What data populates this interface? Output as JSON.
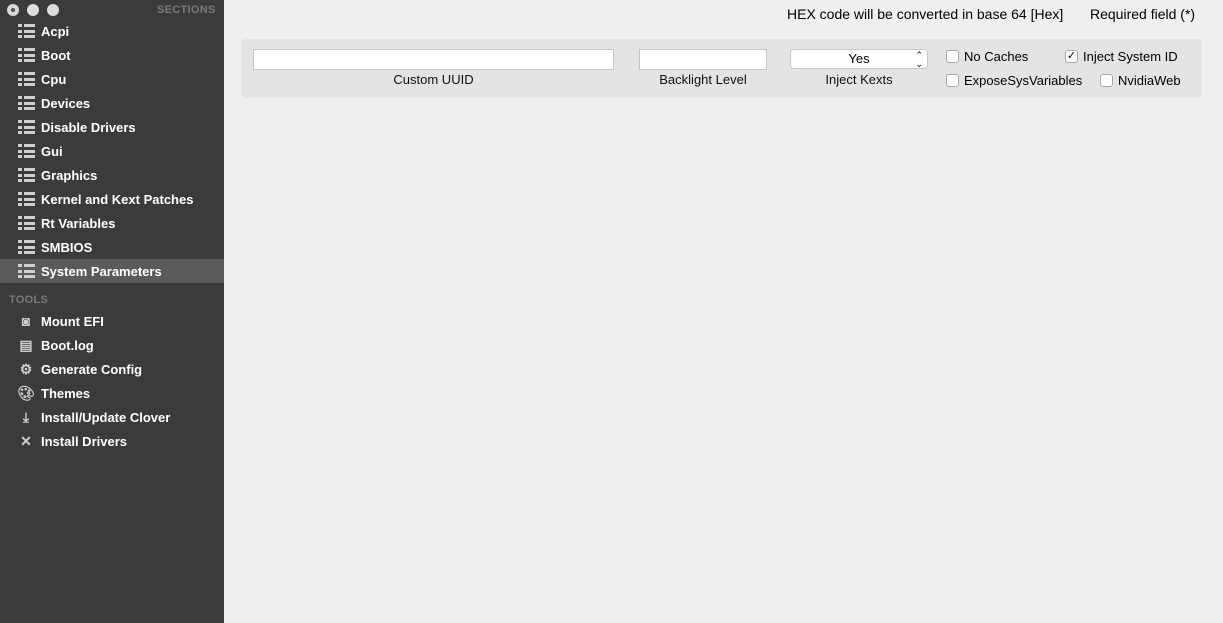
{
  "sidebar": {
    "sections_title": "SECTIONS",
    "sections": [
      {
        "label": "Acpi"
      },
      {
        "label": "Boot"
      },
      {
        "label": "Cpu"
      },
      {
        "label": "Devices"
      },
      {
        "label": "Disable Drivers"
      },
      {
        "label": "Gui"
      },
      {
        "label": "Graphics"
      },
      {
        "label": "Kernel and Kext Patches"
      },
      {
        "label": "Rt Variables"
      },
      {
        "label": "SMBIOS"
      },
      {
        "label": "System Parameters",
        "selected": true
      }
    ],
    "tools_title": "TOOLS",
    "tools": [
      {
        "label": "Mount EFI",
        "icon": "disk-icon"
      },
      {
        "label": "Boot.log",
        "icon": "log-icon"
      },
      {
        "label": "Generate Config",
        "icon": "gear-icon"
      },
      {
        "label": "Themes",
        "icon": "palette-icon"
      },
      {
        "label": "Install/Update Clover",
        "icon": "download-icon"
      },
      {
        "label": "Install Drivers",
        "icon": "tools-icon"
      }
    ]
  },
  "header": {
    "hex_note": "HEX code will be converted in base 64 [Hex]",
    "required_note": "Required field (*)"
  },
  "form": {
    "custom_uuid": {
      "label": "Custom UUID",
      "value": ""
    },
    "backlight_level": {
      "label": "Backlight Level",
      "value": ""
    },
    "inject_kexts": {
      "label": "Inject Kexts",
      "value": "Yes"
    },
    "no_caches": {
      "label": "No Caches",
      "checked": false
    },
    "inject_system_id": {
      "label": "Inject System ID",
      "checked": true
    },
    "expose_sys_variables": {
      "label": "ExposeSysVariables",
      "checked": false
    },
    "nvidia_web": {
      "label": "NvidiaWeb",
      "checked": false
    }
  }
}
